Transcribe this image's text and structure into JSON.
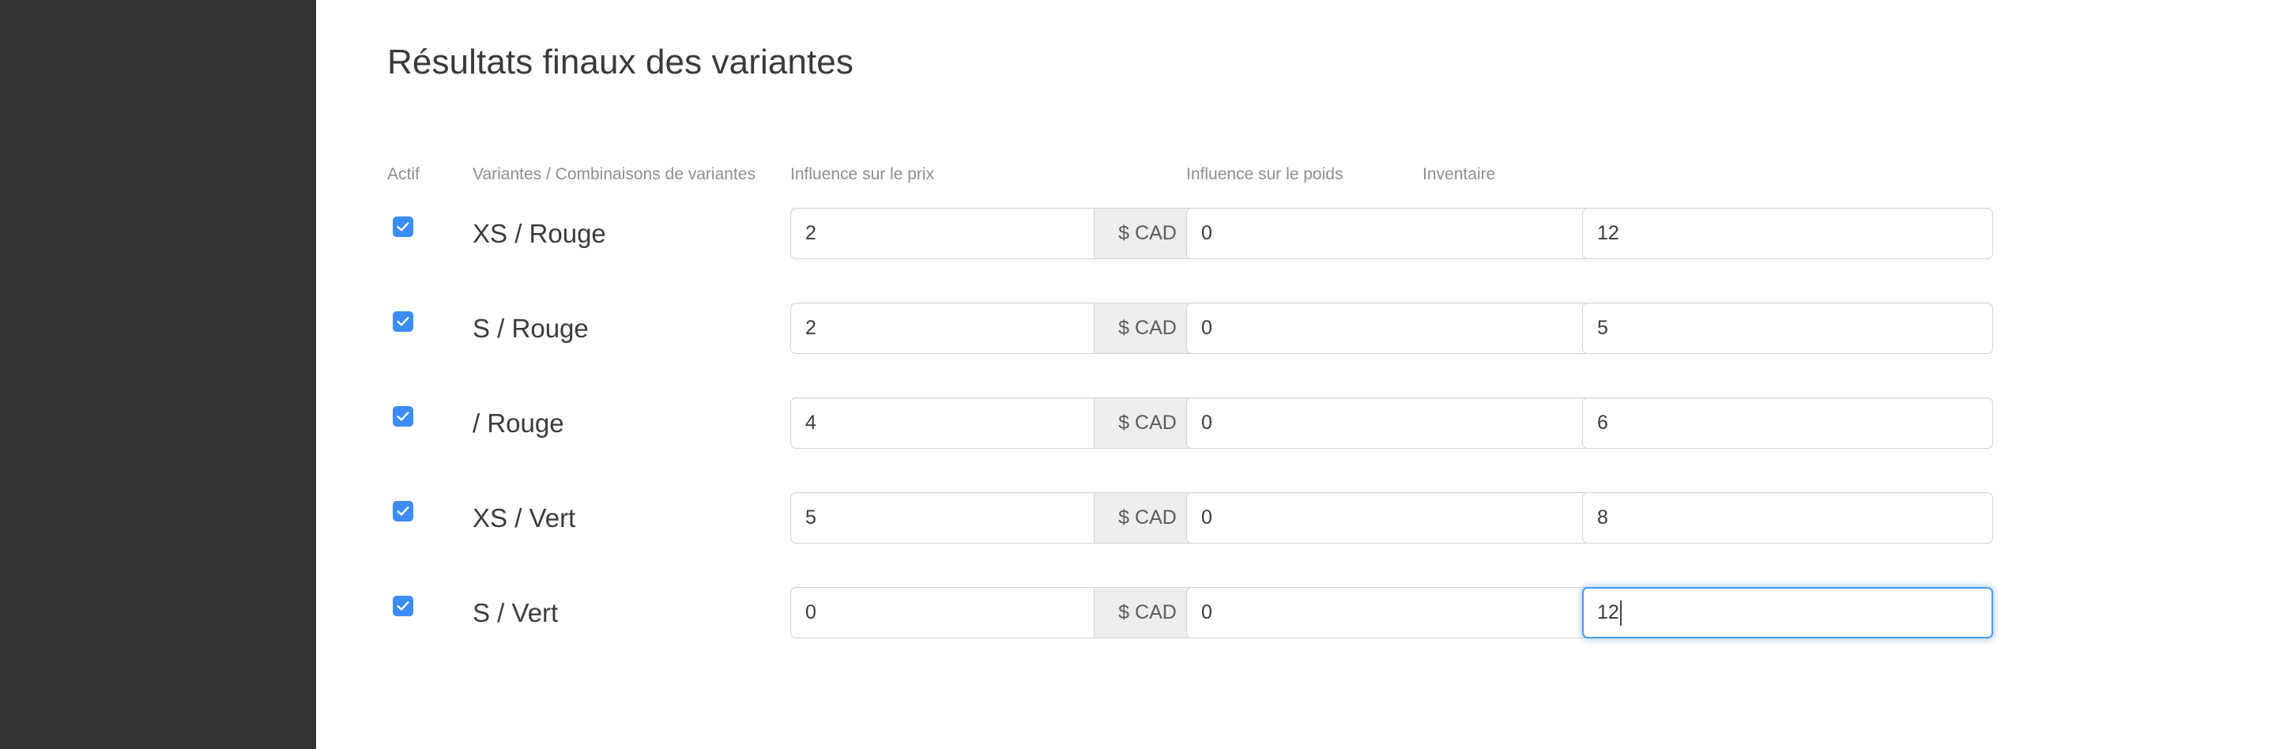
{
  "sidebar": {
    "background": "#333333"
  },
  "page": {
    "title": "Résultats finaux des variantes",
    "accent_color": "#3b8cf5",
    "focus_color": "#4a9cf3"
  },
  "table": {
    "headers": {
      "active": "Actif",
      "variants": "Variantes / Combinaisons de variantes",
      "price": "Influence sur le prix",
      "weight": "Influence sur le poids",
      "inventory": "Inventaire"
    },
    "currency_addon": "$ CAD",
    "rows": [
      {
        "active": true,
        "name": "XS / Rouge",
        "price": "2",
        "weight": "0",
        "inventory": "12",
        "focused": false
      },
      {
        "active": true,
        "name": "S / Rouge",
        "price": "2",
        "weight": "0",
        "inventory": "5",
        "focused": false
      },
      {
        "active": true,
        "name": "/ Rouge",
        "price": "4",
        "weight": "0",
        "inventory": "6",
        "focused": false
      },
      {
        "active": true,
        "name": "XS / Vert",
        "price": "5",
        "weight": "0",
        "inventory": "8",
        "focused": false
      },
      {
        "active": true,
        "name": "S / Vert",
        "price": "0",
        "weight": "0",
        "inventory": "12",
        "focused": true
      }
    ]
  }
}
